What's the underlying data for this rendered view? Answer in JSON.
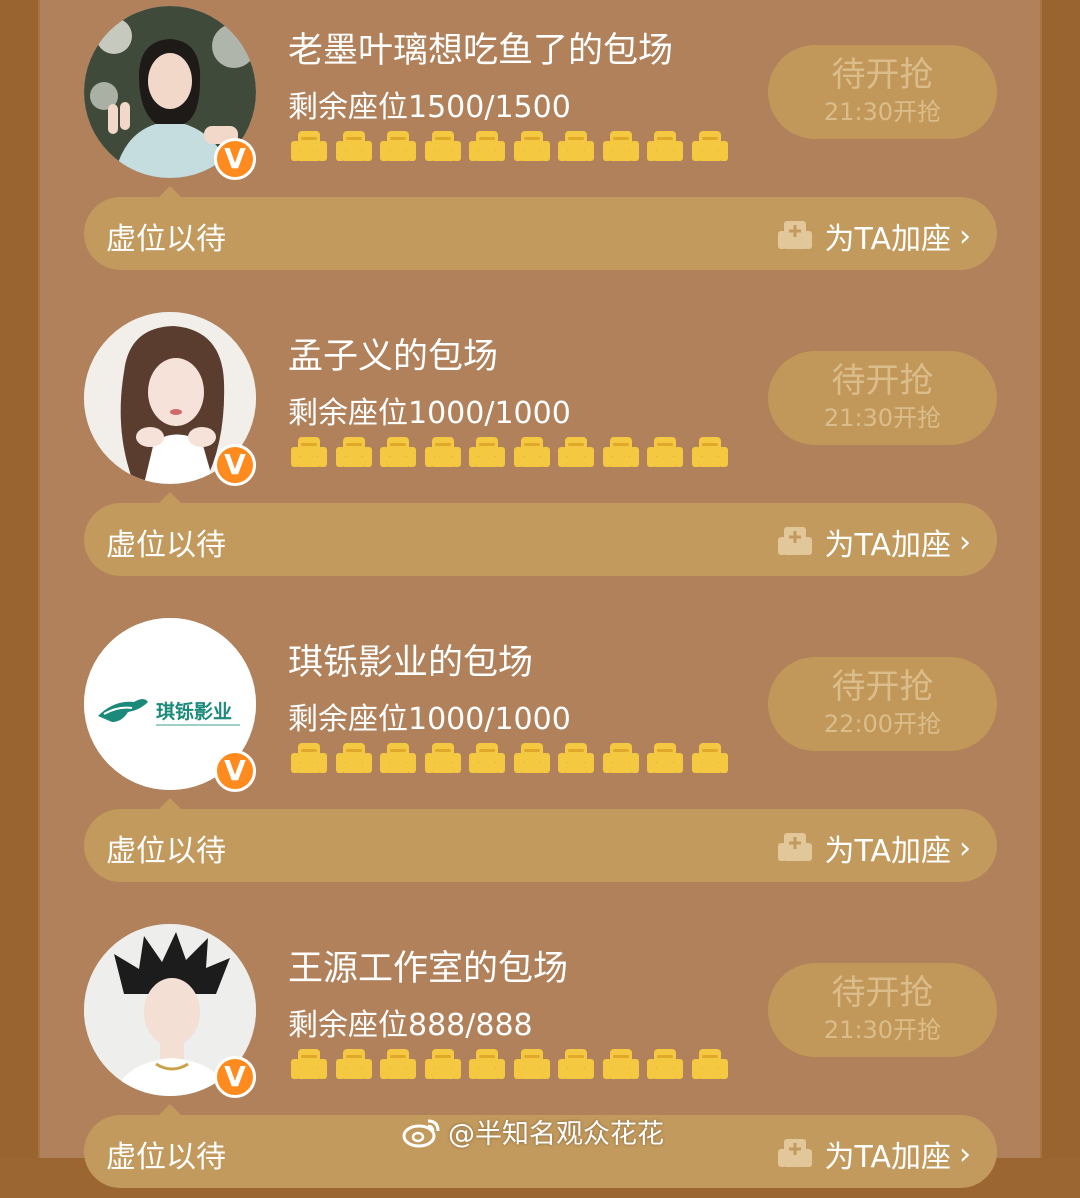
{
  "colors": {
    "panel_bg": "#b0815a",
    "frame": "#9a6431",
    "bar_bg": "#c39a5d",
    "grab_btn_bg": "#c19859",
    "grab_btn_text": "#dbbd8b",
    "seat_icon": "#f5c842",
    "badge": "#ff8a1d"
  },
  "cards": [
    {
      "title": "老墨叶璃想吃鱼了的包场",
      "seats": "剩余座位1500/1500",
      "grab_title": "待开抢",
      "grab_time": "21:30开抢",
      "bar_label": "虚位以待",
      "add_seat_label": "为TA加座",
      "avatar_icon": "woman-portrait-photo",
      "seat_icon_count": 10
    },
    {
      "title": "孟子义的包场",
      "seats": "剩余座位1000/1000",
      "grab_title": "待开抢",
      "grab_time": "21:30开抢",
      "bar_label": "虚位以待",
      "add_seat_label": "为TA加座",
      "avatar_icon": "woman-portrait-photo",
      "seat_icon_count": 10
    },
    {
      "title": "琪铄影业的包场",
      "seats": "剩余座位1000/1000",
      "grab_title": "待开抢",
      "grab_time": "22:00开抢",
      "bar_label": "虚位以待",
      "add_seat_label": "为TA加座",
      "avatar_icon": "company-logo",
      "logo_text": "琪铄影业",
      "seat_icon_count": 10
    },
    {
      "title": "王源工作室的包场",
      "seats": "剩余座位888/888",
      "grab_title": "待开抢",
      "grab_time": "21:30开抢",
      "bar_label": "虚位以待",
      "add_seat_label": "为TA加座",
      "avatar_icon": "man-portrait-photo",
      "seat_icon_count": 10
    }
  ],
  "verified_badge": "V",
  "chevron": "›",
  "watermark": "@半知名观众花花"
}
